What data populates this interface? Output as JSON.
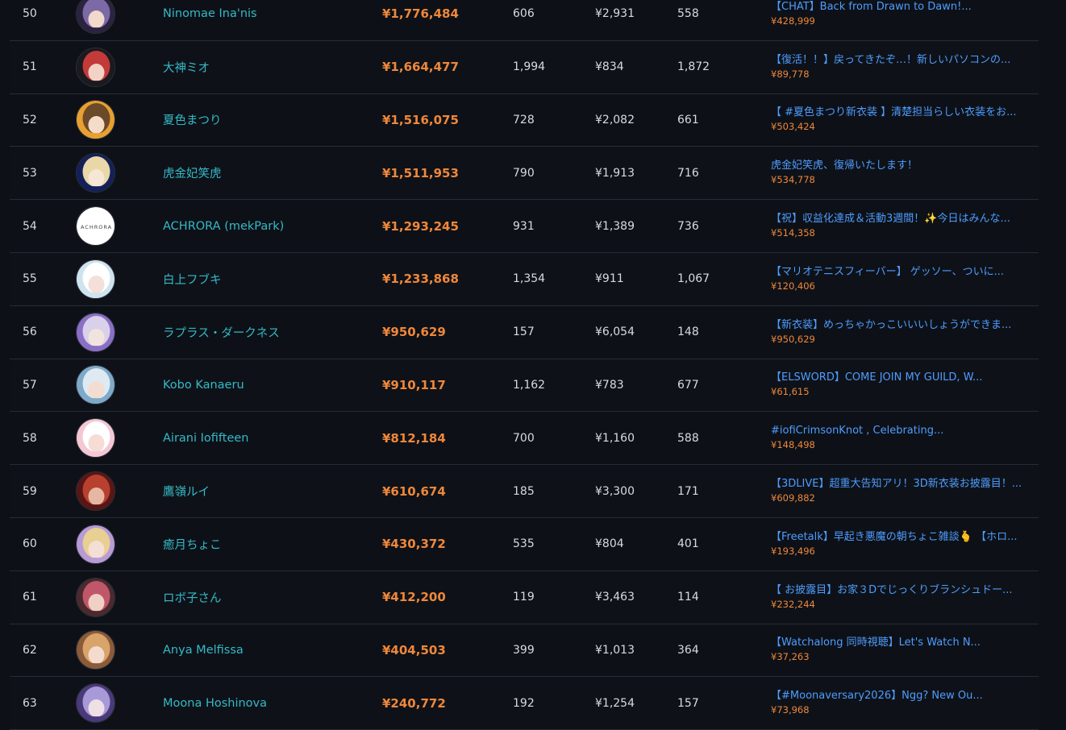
{
  "rows": [
    {
      "rank": "50",
      "name": "Ninomae Ina'nis",
      "total": "¥1,776,484",
      "count": "606",
      "avg": "¥2,931",
      "users": "558",
      "top_title": "【CHAT】Back from Drawn to Dawn!...",
      "top_amount": "¥428,999",
      "avatar_colors": [
        "#2b2340",
        "#7c6aa6",
        "#f1d9cc"
      ]
    },
    {
      "rank": "51",
      "name": "大神ミオ",
      "total": "¥1,664,477",
      "count": "1,994",
      "avg": "¥834",
      "users": "1,872",
      "top_title": "【復活！！】戻ってきたぞ…！新しいパソコンの...",
      "top_amount": "¥89,778",
      "avatar_colors": [
        "#1a1a1f",
        "#c33a3a",
        "#f2d2c4"
      ]
    },
    {
      "rank": "52",
      "name": "夏色まつり",
      "total": "¥1,516,075",
      "count": "728",
      "avg": "¥2,082",
      "users": "661",
      "top_title": "【 #夏色まつり新衣装 】清楚担当らしい衣装をお...",
      "top_amount": "¥503,424",
      "avatar_colors": [
        "#e8a030",
        "#6b4a2a",
        "#f5dcc8"
      ]
    },
    {
      "rank": "53",
      "name": "虎金妃笑虎",
      "total": "¥1,511,953",
      "count": "790",
      "avg": "¥1,913",
      "users": "716",
      "top_title": "虎金妃笑虎、復帰いたします！",
      "top_amount": "¥534,778",
      "avatar_colors": [
        "#14205a",
        "#e9d7a8",
        "#f5e6d6"
      ]
    },
    {
      "rank": "54",
      "name": "ACHRORA (mekPark)",
      "total": "¥1,293,245",
      "count": "931",
      "avg": "¥1,389",
      "users": "736",
      "top_title": "【祝】収益化達成＆活動3週間！✨今日はみんな...",
      "top_amount": "¥514,358",
      "avatar_colors": [
        "#ffffff",
        "#ffffff",
        "#ffffff"
      ],
      "logo_text": "ACHRORA"
    },
    {
      "rank": "55",
      "name": "白上フブキ",
      "total": "¥1,233,868",
      "count": "1,354",
      "avg": "¥911",
      "users": "1,067",
      "top_title": "【マリオテニスフィーバー】 ゲッソー、ついに...",
      "top_amount": "¥120,406",
      "avatar_colors": [
        "#cfe3ef",
        "#ffffff",
        "#f4e0d8"
      ]
    },
    {
      "rank": "56",
      "name": "ラプラス・ダークネス",
      "total": "¥950,629",
      "count": "157",
      "avg": "¥6,054",
      "users": "148",
      "top_title": "【新衣装】めっちゃかっこいいいしょうができま...",
      "top_amount": "¥950,629",
      "avatar_colors": [
        "#8a6fc4",
        "#d9d0ea",
        "#f3e3de"
      ]
    },
    {
      "rank": "57",
      "name": "Kobo Kanaeru",
      "total": "¥910,117",
      "count": "1,162",
      "avg": "¥783",
      "users": "677",
      "top_title": "【ELSWORD】COME JOIN MY GUILD, W...",
      "top_amount": "¥61,615",
      "avatar_colors": [
        "#7fa9c9",
        "#dfe9f1",
        "#f3ddd0"
      ]
    },
    {
      "rank": "58",
      "name": "Airani Iofifteen",
      "total": "¥812,184",
      "count": "700",
      "avg": "¥1,160",
      "users": "588",
      "top_title": "#iofiCrimsonKnot , Celebrating...",
      "top_amount": "¥148,498",
      "avatar_colors": [
        "#f3c7d3",
        "#ffffff",
        "#f6dcd4"
      ]
    },
    {
      "rank": "59",
      "name": "鷹嶺ルイ",
      "total": "¥610,674",
      "count": "185",
      "avg": "¥3,300",
      "users": "171",
      "top_title": "【3DLIVE】超重大告知アリ！3D新衣装お披露目！...",
      "top_amount": "¥609,882",
      "avatar_colors": [
        "#5a1616",
        "#b8402e",
        "#e6b7a2"
      ]
    },
    {
      "rank": "60",
      "name": "癒月ちょこ",
      "total": "¥430,372",
      "count": "535",
      "avg": "¥804",
      "users": "401",
      "top_title": "【Freetalk】早起き悪魔の朝ちょこ雑談🫰 【ホロ...",
      "top_amount": "¥193,496",
      "avatar_colors": [
        "#b79ad6",
        "#e8cf92",
        "#f4dfd6"
      ]
    },
    {
      "rank": "61",
      "name": "ロボ子さん",
      "total": "¥412,200",
      "count": "119",
      "avg": "¥3,463",
      "users": "114",
      "top_title": "【 お披露目】お家３Dでじっくりブランシュドー...",
      "top_amount": "¥232,244",
      "avatar_colors": [
        "#4a2a2e",
        "#c0566a",
        "#f0cfc4"
      ]
    },
    {
      "rank": "62",
      "name": "Anya Melfissa",
      "total": "¥404,503",
      "count": "399",
      "avg": "¥1,013",
      "users": "364",
      "top_title": "【Watchalong 同時視聴】Let's Watch N...",
      "top_amount": "¥37,263",
      "avatar_colors": [
        "#8a5a3a",
        "#d9a46a",
        "#f3dccd"
      ]
    },
    {
      "rank": "63",
      "name": "Moona Hoshinova",
      "total": "¥240,772",
      "count": "192",
      "avg": "¥1,254",
      "users": "157",
      "top_title": "【#Moonaversary2026】Ngg? New Ou...",
      "top_amount": "¥73,968",
      "avatar_colors": [
        "#4a3a7a",
        "#a89ad8",
        "#efe0e6"
      ]
    }
  ]
}
